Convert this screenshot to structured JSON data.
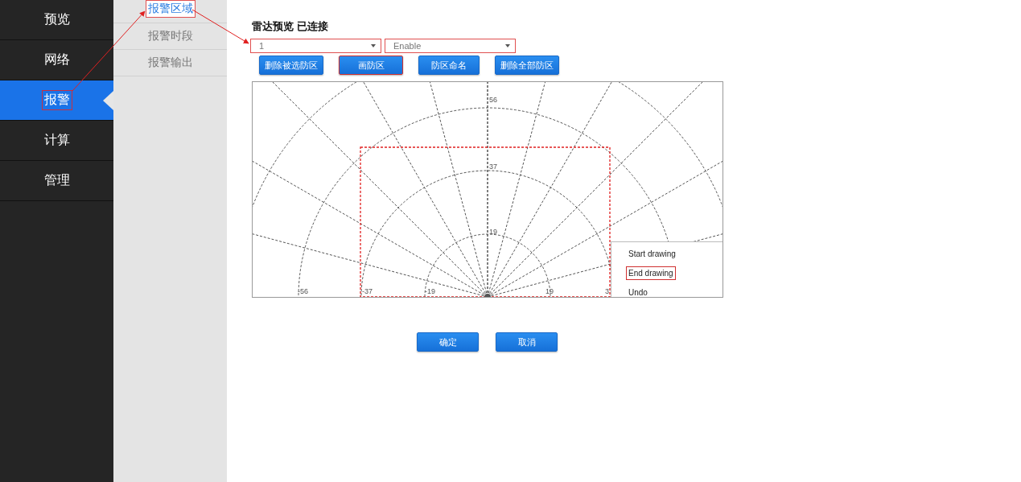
{
  "nav": [
    {
      "label": "预览",
      "selected": false,
      "highlighted": false
    },
    {
      "label": "网络",
      "selected": false,
      "highlighted": false
    },
    {
      "label": "报警",
      "selected": true,
      "highlighted": true
    },
    {
      "label": "计算",
      "selected": false,
      "highlighted": false
    },
    {
      "label": "管理",
      "selected": false,
      "highlighted": false
    }
  ],
  "subnav": [
    {
      "label": "报警区域",
      "selected": true,
      "highlighted": true
    },
    {
      "label": "报警时段",
      "selected": false,
      "highlighted": false
    },
    {
      "label": "报警输出",
      "selected": false,
      "highlighted": false
    }
  ],
  "title": "雷达预览 已连接",
  "selects": [
    {
      "value": "1",
      "highlighted": true
    },
    {
      "value": "Enable",
      "highlighted": true
    }
  ],
  "toolbar": [
    {
      "label": "删除被选防区",
      "highlighted": false
    },
    {
      "label": "画防区",
      "highlighted": true
    },
    {
      "label": "防区命名",
      "highlighted": false
    },
    {
      "label": "删除全部防区",
      "highlighted": false
    }
  ],
  "radar": {
    "top_labels": [
      "56",
      "37",
      "19"
    ],
    "bottom_labels": [
      "-56",
      "-37",
      "-19",
      "19",
      "3"
    ]
  },
  "context_menu": [
    {
      "label": "Start drawing",
      "highlighted": false
    },
    {
      "label": "End drawing",
      "highlighted": true
    },
    {
      "label": "Undo",
      "highlighted": false
    }
  ],
  "actions": [
    "确定",
    "取消"
  ]
}
